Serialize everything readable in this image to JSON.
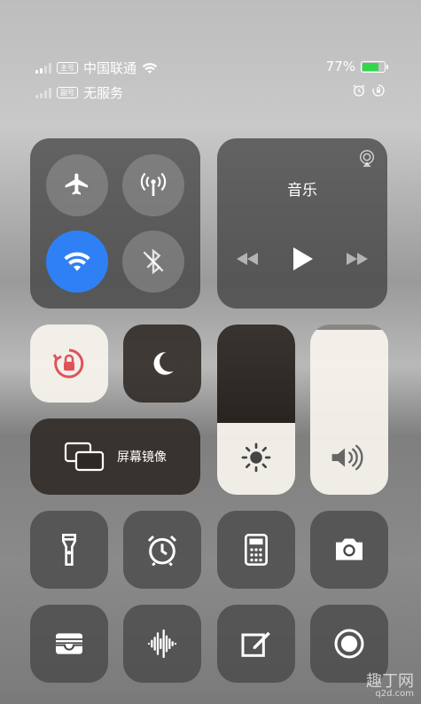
{
  "status": {
    "sim1_badge": "主号",
    "carrier1": "中国联通",
    "sim2_badge": "副号",
    "carrier2": "无服务",
    "battery": "77%",
    "battery_level": 0.77
  },
  "music": {
    "title": "音乐"
  },
  "mirror": {
    "label": "屏幕镜像"
  },
  "brightness_level": 0.42,
  "volume_level": 0.97,
  "watermark": {
    "text": "趣丁网",
    "sub": "q2d.com"
  },
  "icons": {
    "airplane": "airplane-icon",
    "cellular": "cellular-antenna-icon",
    "wifi": "wifi-icon",
    "bluetooth": "bluetooth-off-icon",
    "rotation_lock": "rotation-lock-icon",
    "do_not_disturb": "moon-icon",
    "brightness": "sun-icon",
    "volume": "speaker-icon",
    "flashlight": "flashlight-icon",
    "timer": "alarm-clock-icon",
    "calculator": "calculator-icon",
    "camera": "camera-icon",
    "wallet": "wallet-icon",
    "voice_memo": "waveform-icon",
    "notes": "note-edit-icon",
    "screen_record": "record-icon"
  },
  "colors": {
    "wifi_active": "#2f80f5",
    "battery_fill": "#32d74b",
    "rotation_lock_red": "#e0525a"
  }
}
